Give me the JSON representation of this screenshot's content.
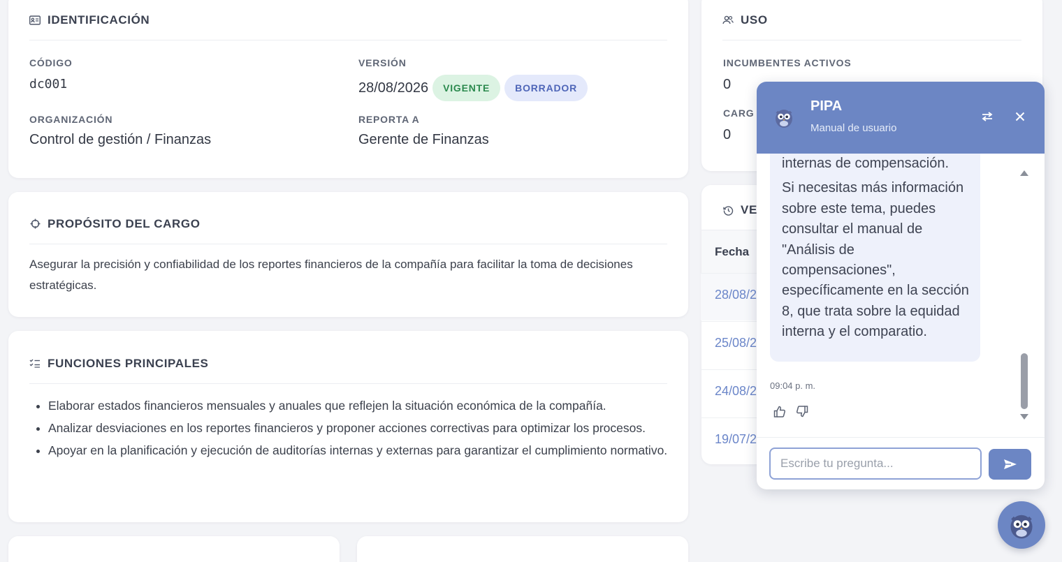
{
  "identificacion": {
    "title": "IDENTIFICACIÓN",
    "codigo_label": "CÓDIGO",
    "codigo_value": "dc001",
    "version_label": "VERSIÓN",
    "version_value": "28/08/2026",
    "badge_vigente": "VIGENTE",
    "badge_borrador": "BORRADOR",
    "organizacion_label": "ORGANIZACIÓN",
    "organizacion_value": "Control de gestión / Finanzas",
    "reporta_label": "REPORTA A",
    "reporta_value": "Gerente de Finanzas"
  },
  "proposito": {
    "title": "PROPÓSITO DEL CARGO",
    "text": "Asegurar la precisión y confiabilidad de los reportes financieros de la compañía para facilitar la toma de decisiones estratégicas."
  },
  "funciones": {
    "title": "FUNCIONES PRINCIPALES",
    "items": [
      "Elaborar estados financieros mensuales y anuales que reflejen la situación económica de la compañía.",
      "Analizar desviaciones en los reportes financieros y proponer acciones correctivas para optimizar los procesos.",
      "Apoyar en la planificación y ejecución de auditorías internas y externas para garantizar el cumplimiento normativo."
    ]
  },
  "uso": {
    "title": "USO",
    "incumbentes_label": "INCUMBENTES ACTIVOS",
    "incumbentes_value": "0",
    "cargos_label": "CARG",
    "cargos_value": "0"
  },
  "versiones": {
    "title": "VE",
    "col_fecha": "Fecha",
    "rows": [
      "28/08/2",
      "25/08/2",
      "24/08/2",
      "19/07/2"
    ]
  },
  "chat": {
    "name": "PIPA",
    "subtitle": "Manual de usuario",
    "message_cut": "internas de compensación.",
    "message": "Si necesitas más información sobre este tema, puedes consultar el manual de \"Análisis de compensaciones\", específicamente en la sección 8, que trata sobre la equidad interna y el comparatio.",
    "time": "09:04 p. m.",
    "input_placeholder": "Escribe tu pregunta..."
  },
  "colors": {
    "accent": "#6c86c4",
    "badge_green_bg": "#dcf3e3",
    "badge_green_text": "#2b8a4e",
    "badge_blue_bg": "#e4e9fb",
    "badge_blue_text": "#4f66b8",
    "link": "#6b86c9"
  },
  "icons": {
    "identificacion": "id-card-icon",
    "proposito": "crosshair-icon",
    "funciones": "list-check-icon",
    "uso": "users-icon",
    "versiones": "history-icon",
    "chat_swap": "swap-icon",
    "chat_close": "close-icon",
    "like": "thumbs-up-icon",
    "dislike": "thumbs-down-icon",
    "send": "send-icon",
    "owl": "owl-avatar-icon"
  }
}
